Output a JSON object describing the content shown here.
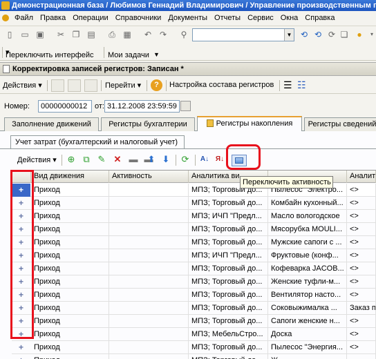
{
  "window": {
    "title": "Демонстрационная база / Любимов Геннадий Владимирович / Управление производственным предприятием"
  },
  "menu": [
    "Файл",
    "Правка",
    "Операции",
    "Справочники",
    "Документы",
    "Отчеты",
    "Сервис",
    "Окна",
    "Справка"
  ],
  "toolbar2": {
    "switch_interface": "Переключить интерфейс",
    "my_tasks": "Мои задачи"
  },
  "document": {
    "title": "Корректировка записей регистров: Записан *",
    "actions_label": "Действия",
    "goto_label": "Перейти",
    "registers_setup": "Настройка состава регистров",
    "number_label": "Номер:",
    "number_value": "00000000012",
    "date_label": "от:",
    "date_value": "31.12.2008 23:59:59"
  },
  "tabs": [
    "Заполнение движений",
    "Регистры бухгалтерии",
    "Регистры накопления",
    "Регистры сведений"
  ],
  "active_tab_index": 2,
  "subtab": "Учет затрат (бухгалтерский и налоговый учет)",
  "grid_toolbar": {
    "actions_label": "Действия",
    "tooltip": "Переключить активность"
  },
  "grid": {
    "columns": [
      "Вид движения",
      "Активность",
      "Аналитика ви...",
      "",
      "Аналити"
    ],
    "rows": [
      {
        "pm": "+",
        "kind": "Приход",
        "active": "",
        "an1": "МПЗ; Торговый до...",
        "an2": "Пылесос \"Электро...",
        "an3": "<>"
      },
      {
        "pm": "+",
        "kind": "Приход",
        "active": "",
        "an1": "МПЗ; Торговый до...",
        "an2": "Комбайн кухонный...",
        "an3": "<>"
      },
      {
        "pm": "+",
        "kind": "Приход",
        "active": "",
        "an1": "МПЗ; ИЧП \"Предл...",
        "an2": "Масло вологодское",
        "an3": "<>"
      },
      {
        "pm": "+",
        "kind": "Приход",
        "active": "",
        "an1": "МПЗ; Торговый до...",
        "an2": "Мясорубка MOULI...",
        "an3": "<>"
      },
      {
        "pm": "+",
        "kind": "Приход",
        "active": "",
        "an1": "МПЗ; Торговый до...",
        "an2": "Мужские сапоги с ...",
        "an3": "<>"
      },
      {
        "pm": "+",
        "kind": "Приход",
        "active": "",
        "an1": "МПЗ; ИЧП \"Предл...",
        "an2": "Фруктовые (конф...",
        "an3": "<>"
      },
      {
        "pm": "+",
        "kind": "Приход",
        "active": "",
        "an1": "МПЗ; Торговый до...",
        "an2": "Кофеварка JACOB...",
        "an3": "<>"
      },
      {
        "pm": "+",
        "kind": "Приход",
        "active": "",
        "an1": "МПЗ; Торговый до...",
        "an2": "Женские туфли-м...",
        "an3": "<>"
      },
      {
        "pm": "+",
        "kind": "Приход",
        "active": "",
        "an1": "МПЗ; Торговый до...",
        "an2": "Вентилятор насто...",
        "an3": "<>"
      },
      {
        "pm": "+",
        "kind": "Приход",
        "active": "",
        "an1": "МПЗ; Торговый до...",
        "an2": "Соковыжималка ...",
        "an3": "Заказ п"
      },
      {
        "pm": "+",
        "kind": "Приход",
        "active": "",
        "an1": "МПЗ; Торговый до...",
        "an2": "Сапоги женские н...",
        "an3": "<>"
      },
      {
        "pm": "+",
        "kind": "Приход",
        "active": "",
        "an1": "МПЗ; МебельСтро...",
        "an2": "Доска",
        "an3": "<>"
      },
      {
        "pm": "+",
        "kind": "Приход",
        "active": "",
        "an1": "МПЗ; Торговый до...",
        "an2": "Пылесос \"Энергия...",
        "an3": "<>"
      },
      {
        "pm": "+",
        "kind": "Приход",
        "active": "",
        "an1": "МПЗ; Торговый до...",
        "an2": "Ж...",
        "an3": ""
      }
    ]
  },
  "colors": {
    "title_bar": "#1e56c0",
    "highlight_red": "#e8101c",
    "tab_accent": "#e8a030",
    "selected_row_marker": "#3a68c8"
  }
}
